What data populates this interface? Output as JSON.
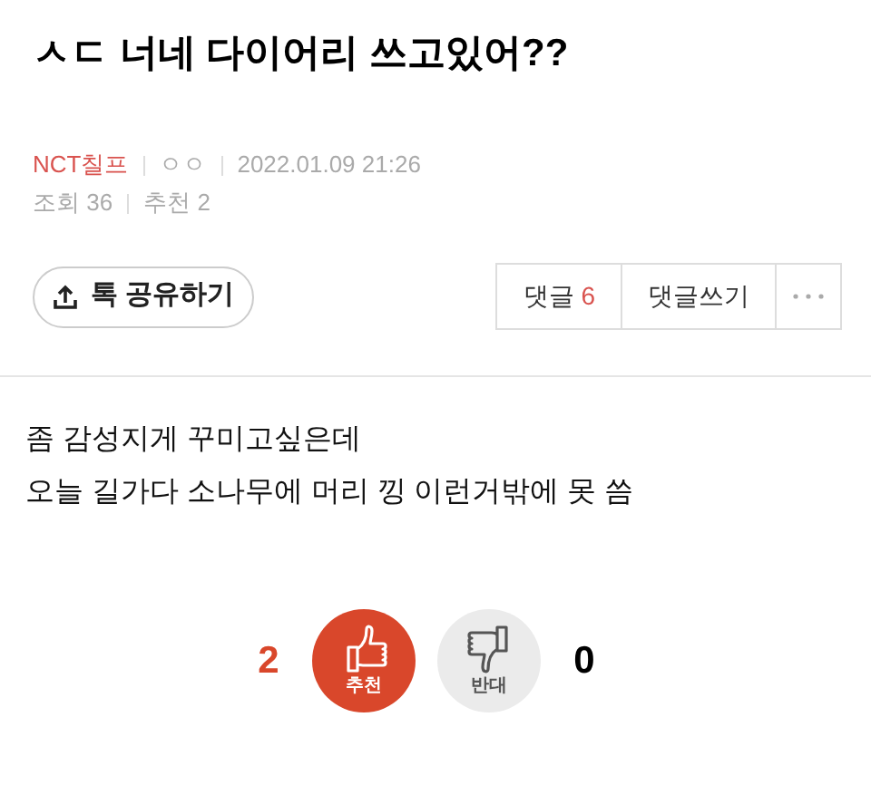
{
  "title": "ㅅㄷ 너네 다이어리 쓰고있어??",
  "meta": {
    "board": "NCT칠프",
    "author": "ㅇㅇ",
    "date": "2022.01.09 21:26",
    "views": "조회 36",
    "recommends": "추천 2"
  },
  "share_button": {
    "label": "톡 공유하기"
  },
  "comment_bar": {
    "comments_label": "댓글",
    "comments_count": "6",
    "write_label": "댓글쓰기"
  },
  "body": [
    "좀 감성지게 꾸미고싶은데",
    "오늘 길가다 소나무에 머리 낑 이런거밖에 못 씀"
  ],
  "votes": [
    {
      "kind": "up",
      "label": "추천",
      "count": "2"
    },
    {
      "kind": "down",
      "label": "반대",
      "count": "0"
    }
  ]
}
